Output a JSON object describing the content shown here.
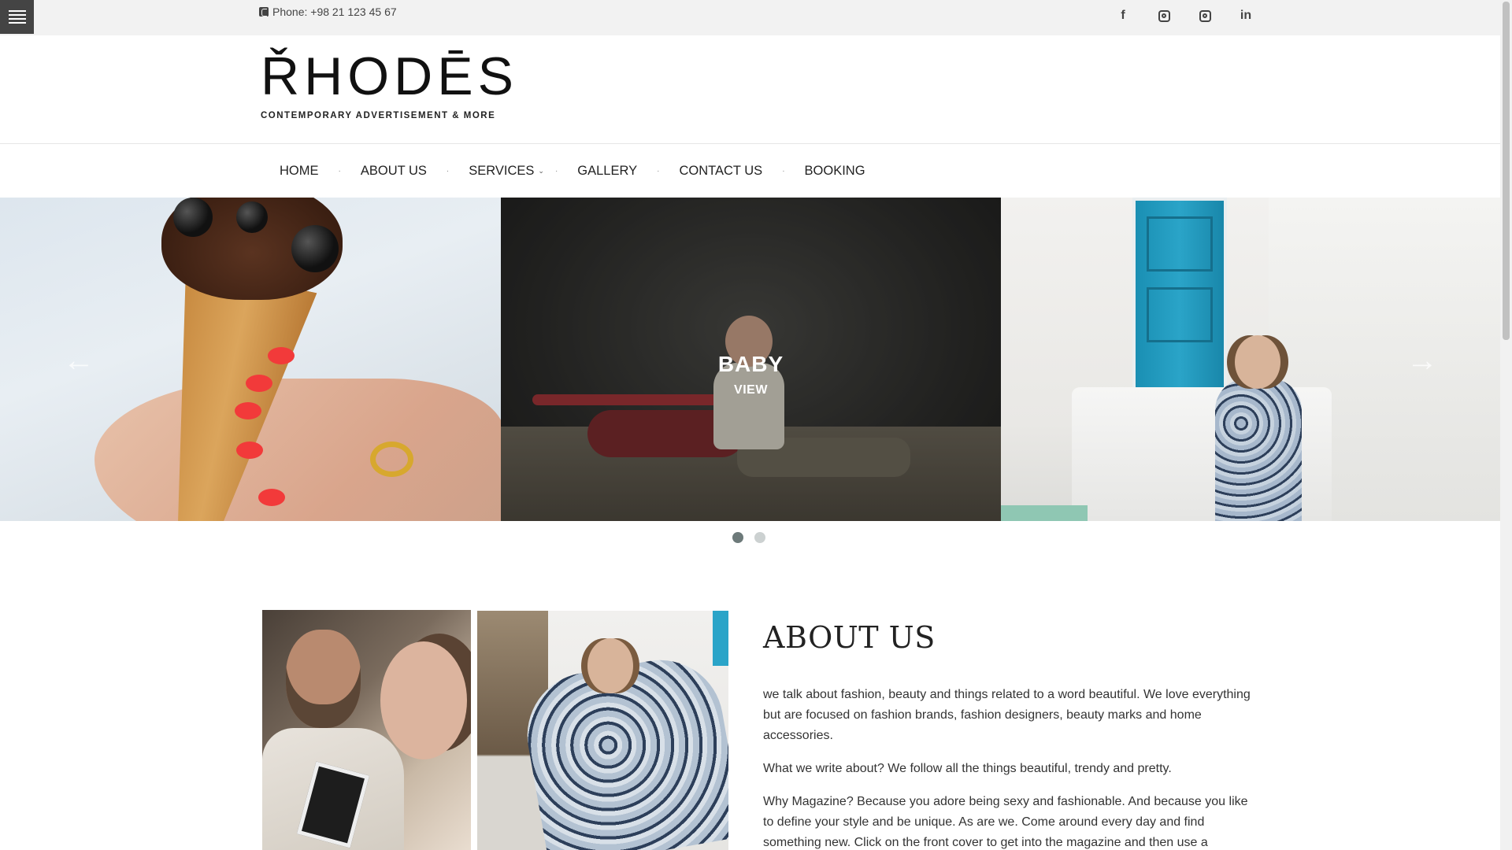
{
  "topbar": {
    "phone_text": "Phone: +98 21 123 45 67",
    "social": [
      "facebook-icon",
      "instagram-icon",
      "instagram-icon",
      "linkedin-icon"
    ]
  },
  "logo": {
    "name": "RHODES",
    "tagline": "CONTEMPORARY ADVERTISEMENT & MORE"
  },
  "nav": {
    "items": [
      {
        "label": "HOME"
      },
      {
        "label": "ABOUT US"
      },
      {
        "label": "SERVICES",
        "has_submenu": true
      },
      {
        "label": "GALLERY"
      },
      {
        "label": "CONTACT US"
      },
      {
        "label": "BOOKING"
      }
    ]
  },
  "slider": {
    "active_caption": {
      "title": "BABY",
      "link": "VIEW"
    },
    "dots": 2,
    "active_dot": 1
  },
  "about": {
    "title": "ABOUT US",
    "paragraphs": [
      "we talk about fashion, beauty and things related to a word beautiful. We love everything but are focused on fashion brands, fashion designers, beauty marks and home accessories.",
      "What we write about? We follow all the things beautiful, trendy and pretty.",
      "Why Magazine? Because you adore being sexy and fashionable. And because you like to define your style and be unique. As are we. Come around every day and find something new. Click on the front cover to get into the magazine and then use a"
    ]
  },
  "colors": {
    "topbar_bg": "#f2f2f2",
    "menu_toggle_bg": "#444444",
    "dot_active": "#6d7a7a",
    "dot_inactive": "#ccd1d1"
  }
}
